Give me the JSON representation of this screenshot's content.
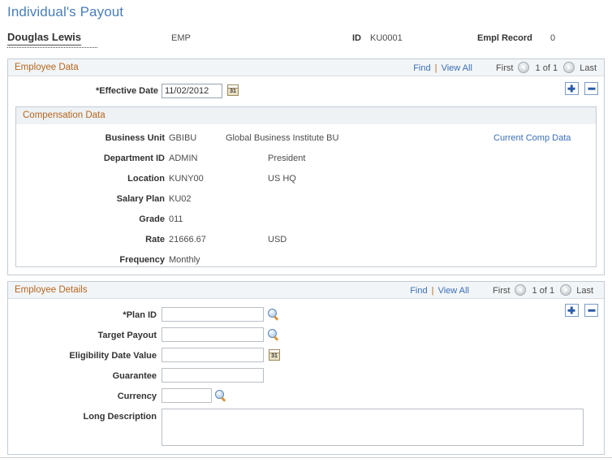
{
  "page": {
    "title": "Individual's Payout"
  },
  "employee_header": {
    "name": "Douglas Lewis",
    "type": "EMP",
    "id_label": "ID",
    "id_value": "KU0001",
    "empl_record_label": "Empl Record",
    "empl_record_value": "0"
  },
  "nav": {
    "find": "Find",
    "separator": "|",
    "view_all": "View All",
    "first": "First",
    "count": "1 of 1",
    "last": "Last",
    "prev_icon": "arrow-left-icon",
    "next_icon": "arrow-right-icon",
    "add_row_icon": "plus-icon",
    "delete_row_icon": "minus-icon"
  },
  "employee_data": {
    "section_title": "Employee Data",
    "effective_date_label": "*Effective Date",
    "effective_date_value": "11/02/2012",
    "calendar_icon": "calendar-icon"
  },
  "compensation_data": {
    "section_title": "Compensation Data",
    "current_comp_link": "Current Comp Data",
    "rows": [
      {
        "label": "Business Unit",
        "value": "GBIBU",
        "description": "Global Business Institute BU"
      },
      {
        "label": "Department ID",
        "value": "ADMIN",
        "description": "President"
      },
      {
        "label": "Location",
        "value": "KUNY00",
        "description": "US HQ"
      },
      {
        "label": "Salary Plan",
        "value": "KU02",
        "description": ""
      },
      {
        "label": "Grade",
        "value": "011",
        "description": ""
      },
      {
        "label": "Rate",
        "value": "21666.67",
        "description": "USD"
      },
      {
        "label": "Frequency",
        "value": "Monthly",
        "description": ""
      }
    ]
  },
  "employee_details": {
    "section_title": "Employee Details",
    "fields": [
      {
        "label": "*Plan ID",
        "value": "",
        "icon": "magnifier-icon"
      },
      {
        "label": "Target Payout",
        "value": "",
        "icon": "magnifier-icon"
      },
      {
        "label": "Eligibility Date Value",
        "value": "",
        "icon": "calendar-icon"
      },
      {
        "label": "Guarantee",
        "value": "",
        "icon": ""
      },
      {
        "label": "Currency",
        "value": "",
        "icon": "magnifier-icon"
      },
      {
        "label": "Long Description",
        "value": "",
        "icon": ""
      }
    ]
  },
  "colors": {
    "title_blue": "#4a7ebb",
    "section_orange": "#b5651d",
    "link_blue": "#3b6fb6",
    "border_gray": "#c3ccd4"
  }
}
